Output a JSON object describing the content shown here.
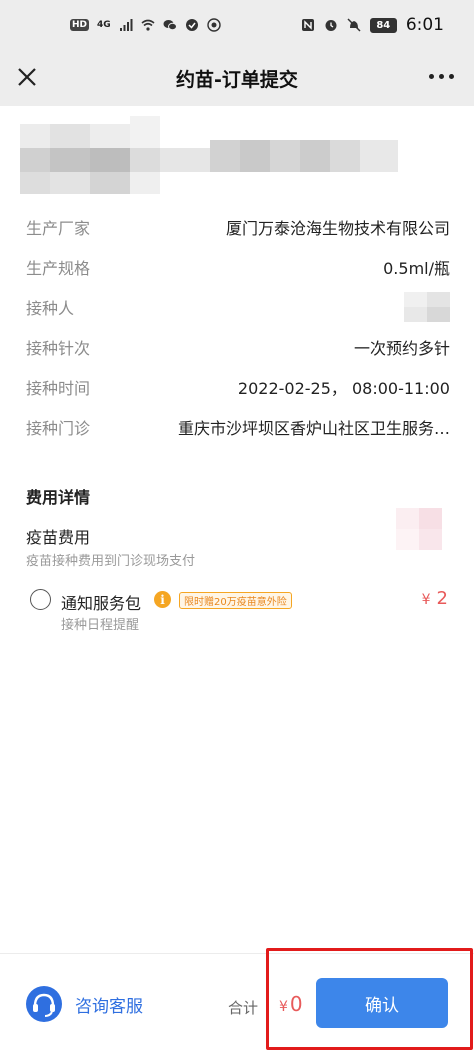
{
  "status_bar": {
    "left_badges": [
      "HD",
      "4G"
    ],
    "battery": "84",
    "time": "6:01",
    "icons": [
      "signal-icon",
      "wifi-icon",
      "wechat-icon",
      "vpn-icon",
      "camera-app-icon",
      "nfc-icon",
      "alarm-icon",
      "mute-icon",
      "battery-icon"
    ]
  },
  "nav": {
    "title": "约苗-订单提交",
    "close_icon": "close-icon",
    "more_icon": "more-icon"
  },
  "order_info": [
    {
      "label": "生产厂家",
      "value": "厦门万泰沧海生物技术有限公司"
    },
    {
      "label": "生产规格",
      "value": "0.5ml/瓶"
    },
    {
      "label": "接种人",
      "value": ""
    },
    {
      "label": "接种针次",
      "value": "一次预约多针"
    },
    {
      "label": "接种时间",
      "value": "2022-02-25， 08:00-11:00"
    },
    {
      "label": "接种门诊",
      "value": "重庆市沙坪坝区香炉山社区卫生服务…"
    }
  ],
  "fees": {
    "section_title": "费用详情",
    "vaccine_fee_label": "疫苗费用",
    "vaccine_fee_note": "疫苗接种费用到门诊现场支付",
    "package": {
      "name": "通知服务包",
      "badge": "限时赠20万疫苗意外险",
      "currency": "¥",
      "price": "2",
      "description": "接种日程提醒",
      "selected": false
    }
  },
  "bottom_bar": {
    "customer_service_label": "咨询客服",
    "total_label": "合计",
    "total_currency": "¥",
    "total_value": "0",
    "confirm_label": "确认"
  },
  "colors": {
    "accent_blue": "#3d86ea",
    "price_red": "#e85a5a",
    "badge_orange": "#f5a623",
    "highlight_red": "#e21b1b"
  }
}
